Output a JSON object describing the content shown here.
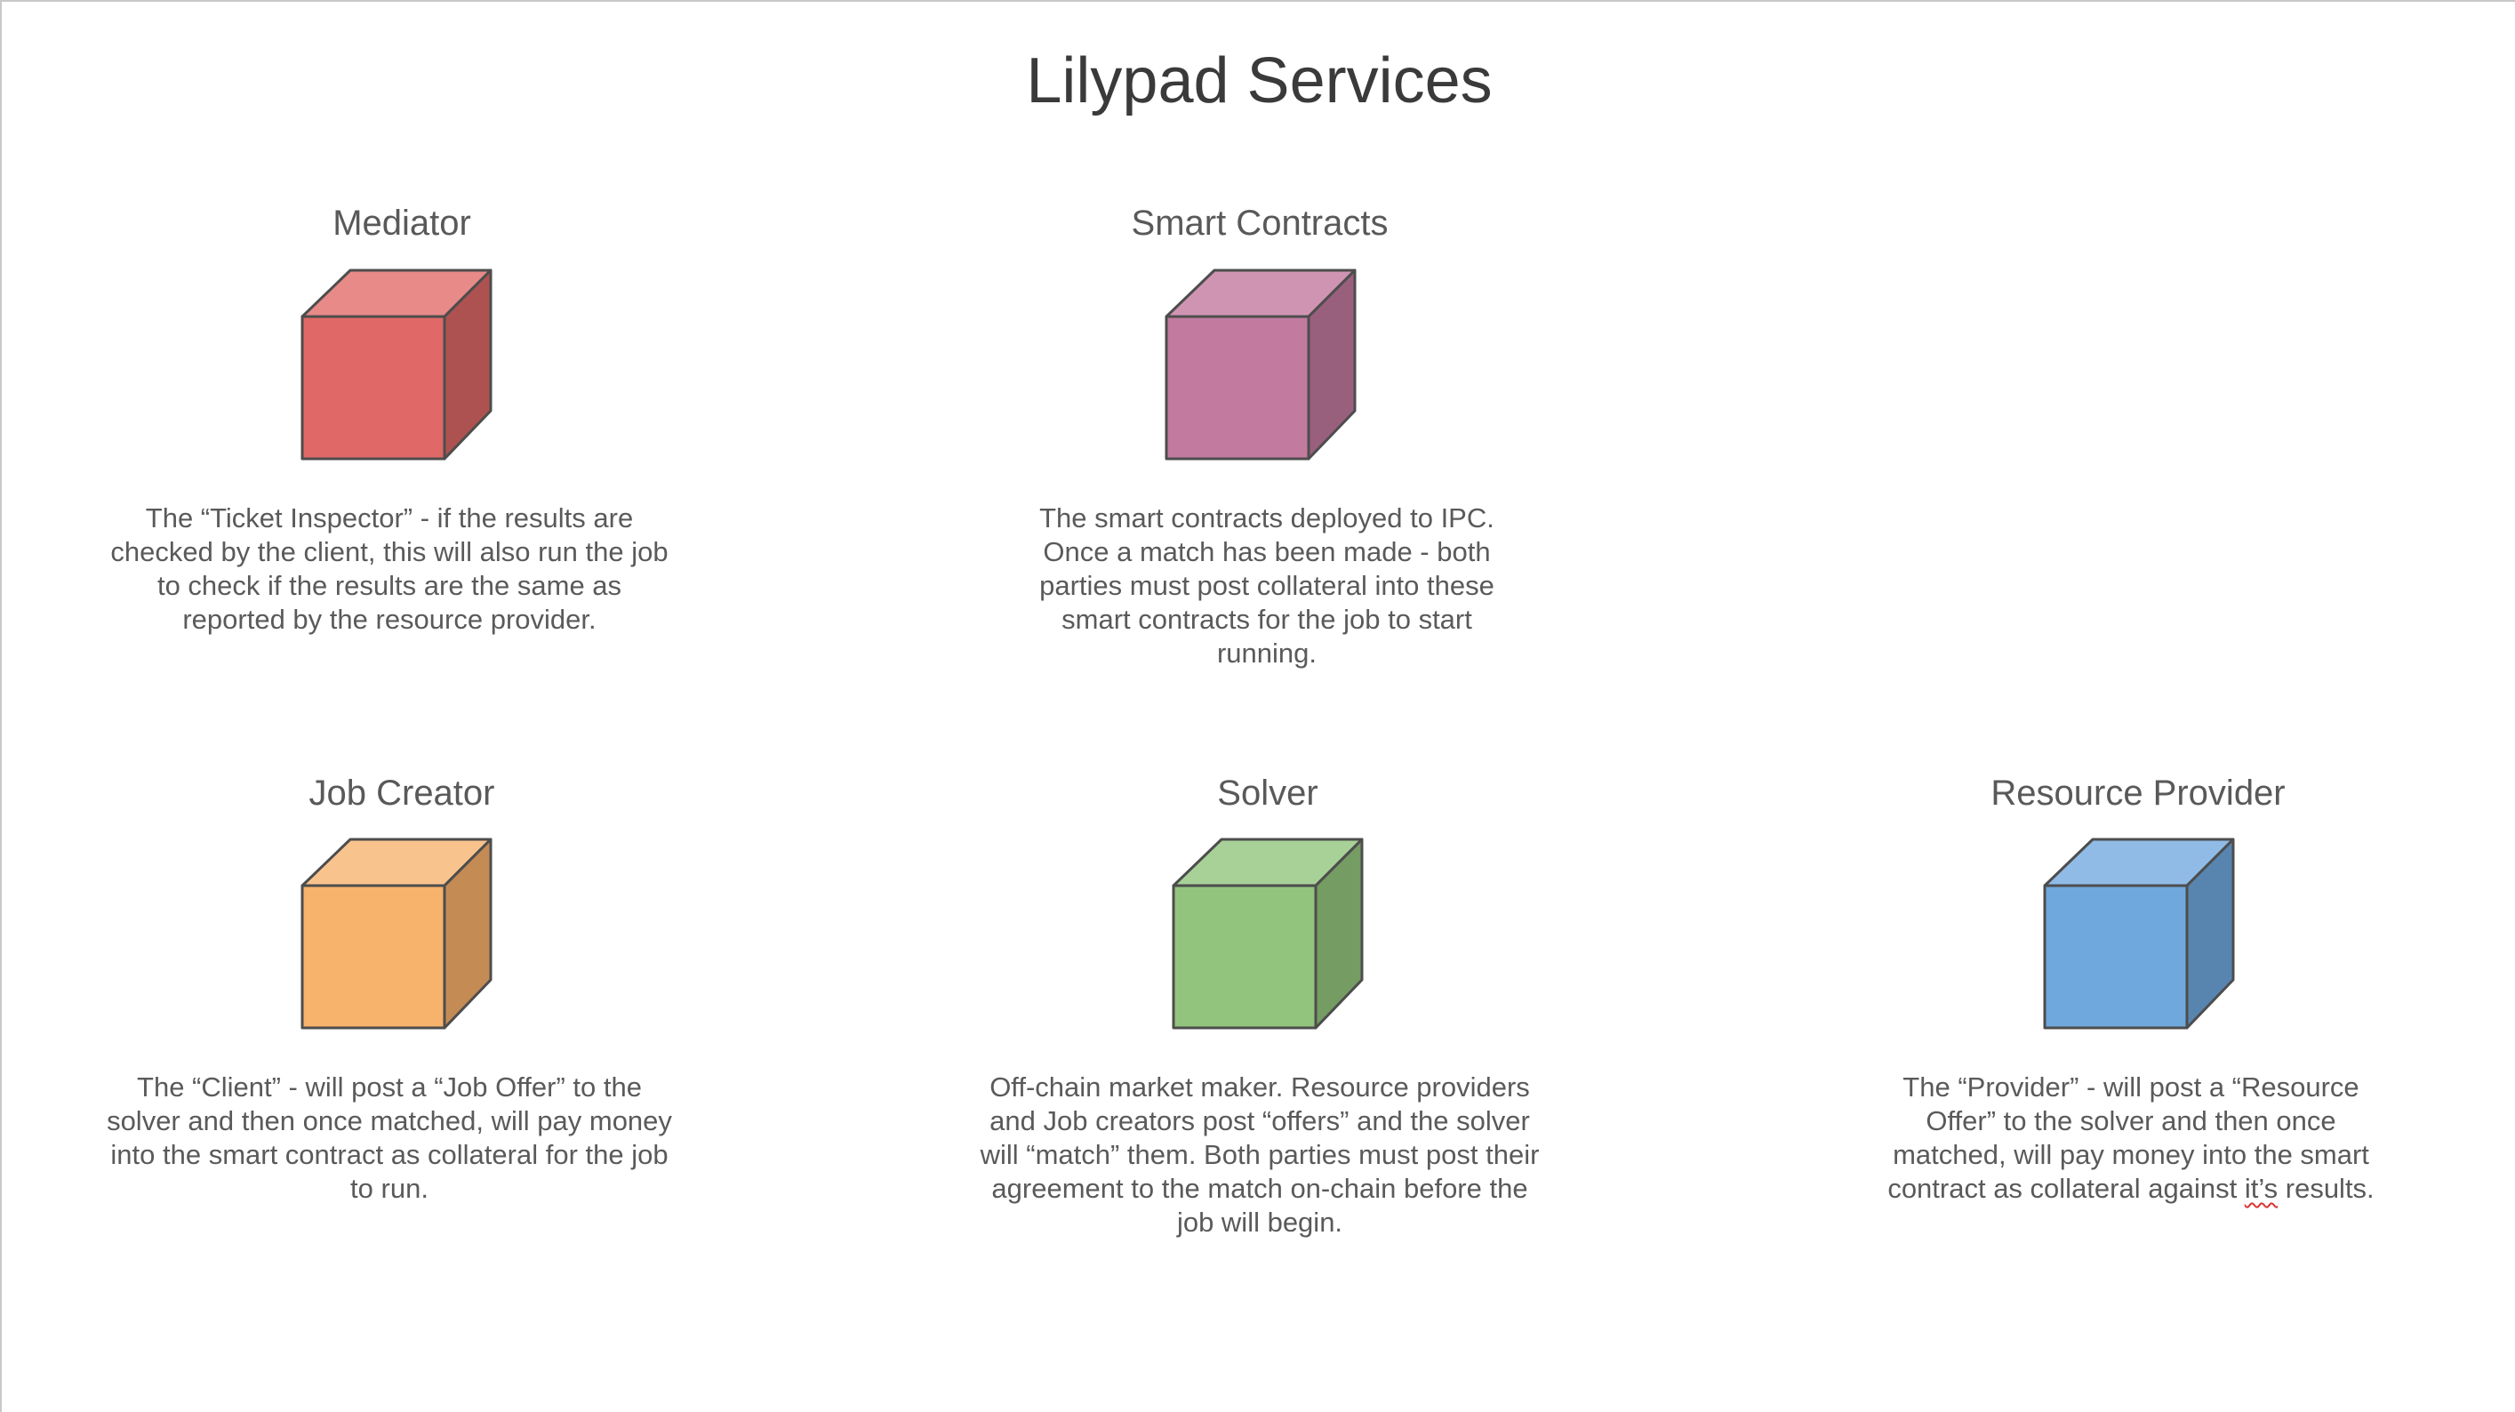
{
  "title": "Lilypad Services",
  "services": [
    {
      "key": "mediator",
      "title": "Mediator",
      "description": "The “Ticket Inspector” - if the results are checked by the client, this will also run the job to check if the results are the same as reported by the resource provider.",
      "colors": {
        "top": "#e88a88",
        "front": "#e06866",
        "side": "#ad5250"
      }
    },
    {
      "key": "smart-contracts",
      "title": "Smart Contracts",
      "description": "The smart contracts deployed to IPC. Once a match has been made - both parties must post collateral into these smart contracts for the job to start running.",
      "colors": {
        "top": "#d094b3",
        "front": "#c27a9f",
        "side": "#99607e"
      }
    },
    {
      "key": "job-creator",
      "title": "Job Creator",
      "description": "The “Client” - will post a “Job Offer” to the solver and then once matched, will pay money into the smart contract as collateral for the job to run.",
      "colors": {
        "top": "#f9c38e",
        "front": "#f7b26c",
        "side": "#c48b55"
      }
    },
    {
      "key": "solver",
      "title": "Solver",
      "description": "Off-chain market maker.  Resource providers and Job creators post “offers” and the solver will “match” them.  Both parties must post their agreement to the match on-chain before the job will begin.",
      "colors": {
        "top": "#a8d198",
        "front": "#93c47d",
        "side": "#749c63"
      }
    },
    {
      "key": "resource-provider",
      "title": "Resource Provider",
      "description_parts": [
        "The “Provider” - will post a “Resource Offer” to the solver and then once matched, will pay money into the smart contract as collateral against ",
        "it’s",
        " results."
      ],
      "colors": {
        "top": "#8fbbe6",
        "front": "#6fa8dc",
        "side": "#5885b0"
      }
    }
  ]
}
